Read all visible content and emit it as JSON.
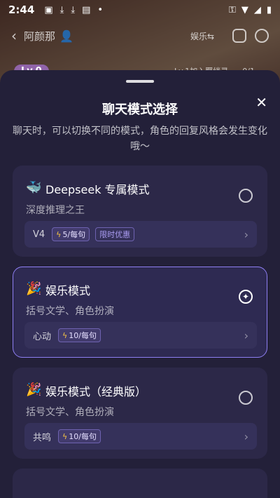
{
  "status_bar": {
    "time": "2:44"
  },
  "top_bar": {
    "back": "‹",
    "name": "阿颜那",
    "mode": "娱乐⇆"
  },
  "level": {
    "label": "Lv.0",
    "join": "Lv.1加入羁绊录",
    "count": "0/1"
  },
  "sheet": {
    "title": "聊天模式选择",
    "subtitle": "聊天时，可以切换不同的模式，角色的回复风格会发生变化哦～",
    "close_label": "✕"
  },
  "modes": [
    {
      "emoji": "🐳",
      "name": "Deepseek 专属模式",
      "desc": "深度推理之王",
      "version": "V4",
      "cost": "5/每句",
      "promo": "限时优惠",
      "selected": false
    },
    {
      "emoji": "🎉",
      "name": "娱乐模式",
      "desc": "括号文学、角色扮演",
      "version": "心动",
      "cost": "10/每句",
      "promo": "",
      "selected": true
    },
    {
      "emoji": "🎉",
      "name": "娱乐模式（经典版）",
      "desc": "括号文学、角色扮演",
      "version": "共鸣",
      "cost": "10/每句",
      "promo": "",
      "selected": false
    }
  ]
}
